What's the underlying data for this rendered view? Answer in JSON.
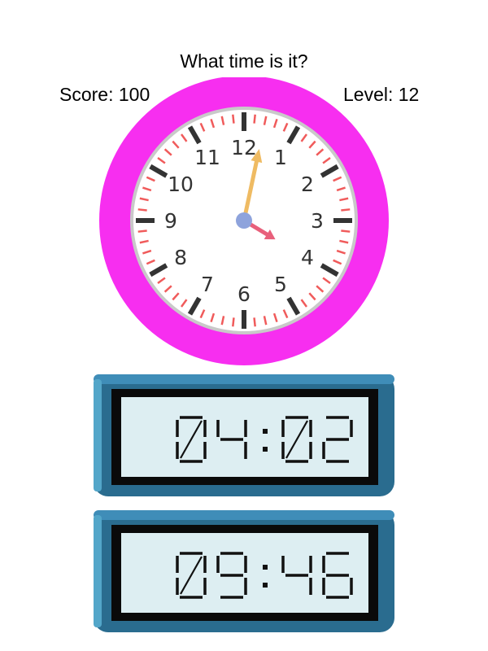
{
  "header": {
    "question": "What time is it?",
    "score_text": "Score: 100",
    "level_text": "Level: 12"
  },
  "clock": {
    "hour": 4,
    "minute": 2,
    "numbers": [
      "12",
      "1",
      "2",
      "3",
      "4",
      "5",
      "6",
      "7",
      "8",
      "9",
      "10",
      "11"
    ],
    "colors": {
      "ring": "#f72ef0",
      "face": "#ffffff",
      "face_edge": "#c9c9c9",
      "major_tick": "#333333",
      "minor_tick": "#f05b5b",
      "numbers": "#333333",
      "hour_hand": "#e8607b",
      "minute_hand": "#efbb63",
      "center": "#8ea3dc"
    }
  },
  "answers": [
    {
      "time": "04:02"
    },
    {
      "time": "09:46"
    }
  ],
  "lcd_colors": {
    "body": "#2a6c8f",
    "body_top": "#3f8db8",
    "body_left": "#53a6c9",
    "bezel": "#0a0a0a",
    "screen": "#ddeef2",
    "digit": "#111111"
  }
}
